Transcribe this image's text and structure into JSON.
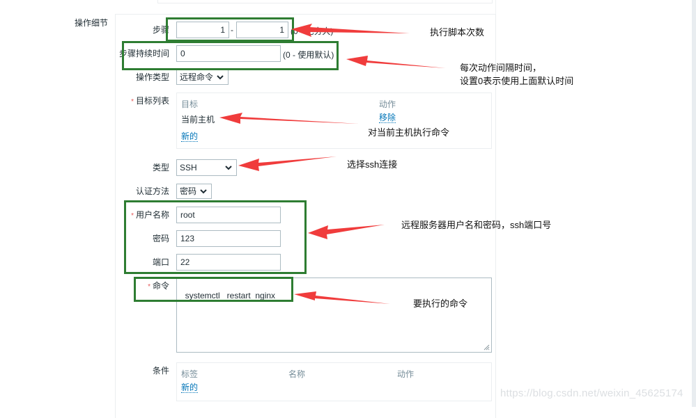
{
  "section": {
    "label": "操作细节"
  },
  "form": {
    "steps": {
      "label": "步骤",
      "from": "1",
      "to": "1",
      "separator": "-",
      "hint": "(0 - 无穷大)"
    },
    "step_duration": {
      "label": "步骤持续时间",
      "value": "0",
      "hint": "(0 - 使用默认)"
    },
    "operation_type": {
      "label": "操作类型",
      "selected": "远程命令",
      "icon": "chevron-down-icon"
    },
    "target_list": {
      "label": "目标列表",
      "required": "*",
      "columns": [
        "目标",
        "动作"
      ],
      "rows": [
        {
          "target": "当前主机",
          "action": "移除"
        }
      ],
      "add_link": "新的"
    },
    "type": {
      "label": "类型",
      "selected": "SSH",
      "icon": "chevron-down-icon"
    },
    "auth_method": {
      "label": "认证方法",
      "selected": "密码",
      "icon": "chevron-down-icon"
    },
    "username": {
      "label": "用户名称",
      "required": "*",
      "value": "root"
    },
    "password": {
      "label": "密码",
      "value": "123"
    },
    "port": {
      "label": "端口",
      "value": "22"
    },
    "command": {
      "label": "命令",
      "required": "*",
      "value": "systemctl   restart  nginx"
    },
    "conditions": {
      "label": "条件",
      "columns": [
        "标签",
        "名称",
        "动作"
      ],
      "add_link": "新的"
    }
  },
  "annotations": [
    {
      "id": "steps-note",
      "text": "执行脚本次数"
    },
    {
      "id": "duration-note-line1",
      "text": "每次动作间隔时间，"
    },
    {
      "id": "duration-note-line2",
      "text": "设置0表示使用上面默认时间"
    },
    {
      "id": "target-note",
      "text": "对当前主机执行命令"
    },
    {
      "id": "type-note",
      "text": "选择ssh连接"
    },
    {
      "id": "credentials-note",
      "text": "远程服务器用户名和密码，ssh端口号"
    },
    {
      "id": "command-note",
      "text": "要执行的命令"
    }
  ],
  "colors": {
    "annotation_box": "#2e7d32",
    "annotation_arrow": "#f03c3c",
    "link": "#0275b8",
    "required": "#e45959",
    "input_border": "#acbbc2"
  },
  "watermark": "https://blog.csdn.net/weixin_45625174"
}
